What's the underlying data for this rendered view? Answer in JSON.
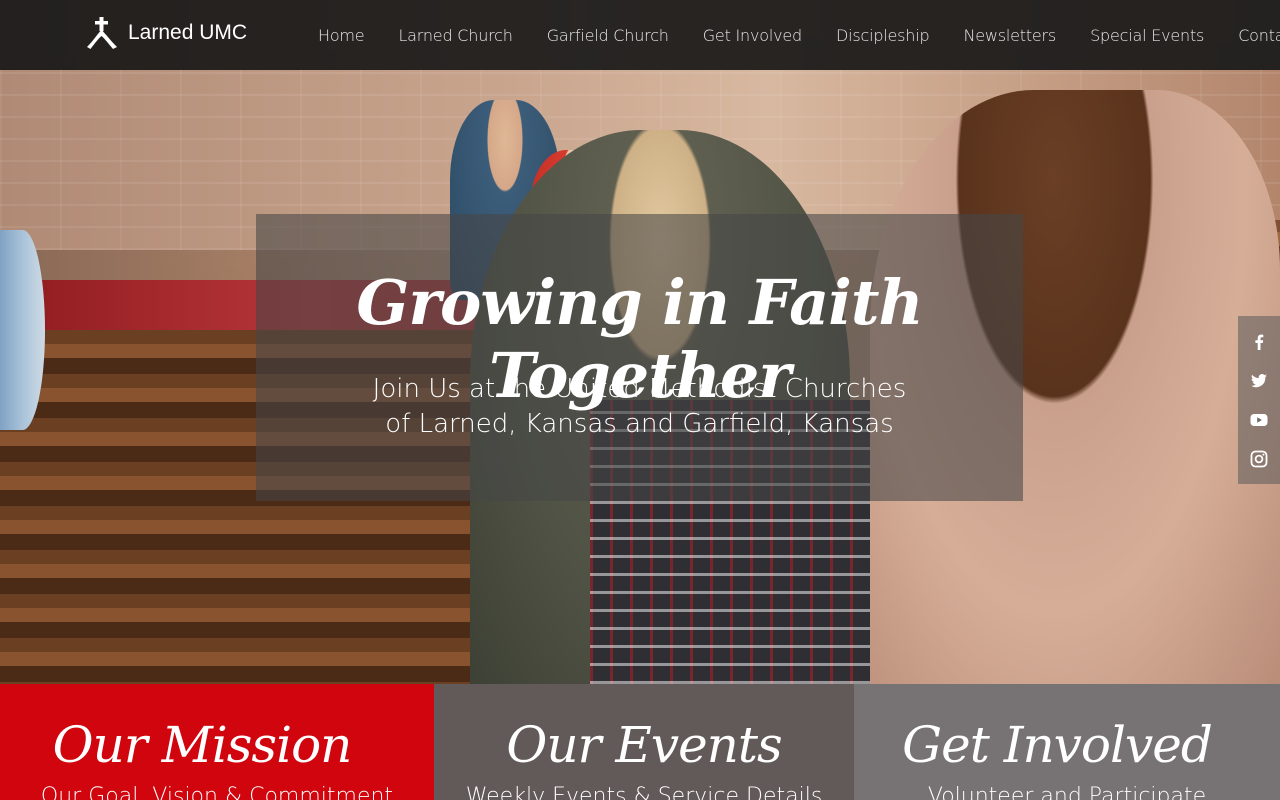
{
  "header": {
    "site_title": "Larned UMC",
    "logo_icon": "cross-flame-icon"
  },
  "nav": {
    "items": [
      {
        "label": "Home"
      },
      {
        "label": "Larned Church"
      },
      {
        "label": "Garfield Church"
      },
      {
        "label": "Get Involved"
      },
      {
        "label": "Discipleship"
      },
      {
        "label": "Newsletters"
      },
      {
        "label": "Special Events"
      },
      {
        "label": "Contact"
      }
    ]
  },
  "hero": {
    "heading": "Growing in Faith Together",
    "subheading_line1": "Join Us at the United Methodist Churches",
    "subheading_line2": "of Larned, Kansas and Garfield, Kansas"
  },
  "social": {
    "icons": [
      "facebook-icon",
      "twitter-icon",
      "youtube-icon",
      "instagram-icon"
    ]
  },
  "tiles": [
    {
      "title": "Our Mission",
      "subtitle": "Our Goal, Vision & Commitment",
      "color": "#d0050d"
    },
    {
      "title": "Our Events",
      "subtitle": "Weekly Events & Service Details",
      "color": "#625a58"
    },
    {
      "title": "Get Involved",
      "subtitle": "Volunteer and Participate",
      "color": "#777374"
    }
  ]
}
